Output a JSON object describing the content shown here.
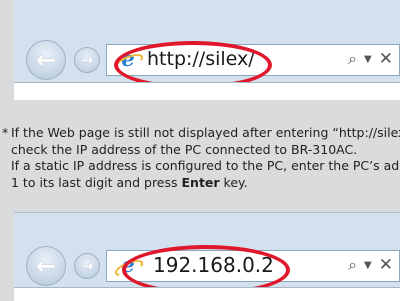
{
  "browser_top": {
    "address": "http://silex/"
  },
  "browser_bottom": {
    "address": "192.168.0.2"
  },
  "note": {
    "star": "*",
    "line1": "If the Web page is still not displayed after entering “http://silex",
    "line2": "check the IP address of the PC connected to BR-310AC.",
    "line3": "If a static IP address is configured to the PC, enter the PC’s add",
    "line4_pre": "1 to its last digit and press ",
    "line4_key": "Enter",
    "line4_post": " key."
  },
  "colors": {
    "highlight": "#e0172b",
    "browser_chrome": "#d3e1ef",
    "page_background": "#d9dbdc"
  },
  "icons": {
    "back": "back-arrow-icon",
    "forward": "forward-arrow-icon",
    "ie": "ie-logo-icon",
    "search": "search-icon",
    "dropdown": "dropdown-icon",
    "close": "close-icon"
  }
}
